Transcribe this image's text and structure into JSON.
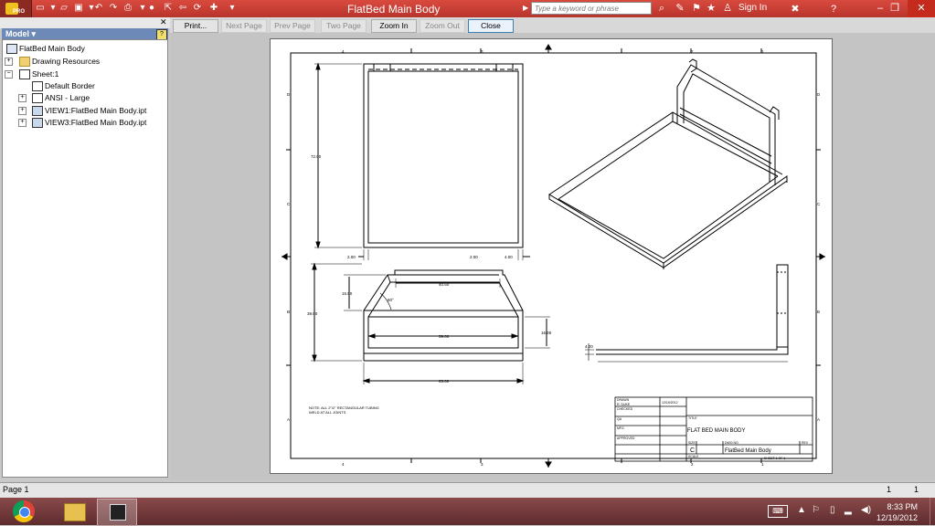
{
  "window": {
    "title": "FlatBed Main Body",
    "app_badge": "PRO",
    "search_placeholder": "Type a keyword or phrase",
    "sign_in": "Sign In"
  },
  "browser": {
    "header": "Model",
    "help_glyph": "?",
    "tree": [
      {
        "label": "FlatBed Main Body",
        "icon": "drawing-icon",
        "level": 0
      },
      {
        "label": "Drawing Resources",
        "icon": "folder-icon",
        "level": 1,
        "expander": "+"
      },
      {
        "label": "Sheet:1",
        "icon": "sheet-icon",
        "level": 1,
        "expander": "-"
      },
      {
        "label": "Default Border",
        "icon": "border-icon",
        "level": 2
      },
      {
        "label": "ANSI - Large",
        "icon": "titleblock-icon",
        "level": 2,
        "expander": "+"
      },
      {
        "label": "VIEW1:FlatBed Main Body.ipt",
        "icon": "view-icon",
        "level": 2,
        "expander": "+"
      },
      {
        "label": "VIEW3:FlatBed Main Body.ipt",
        "icon": "view-icon",
        "level": 2,
        "expander": "+"
      }
    ]
  },
  "toolbar": {
    "print": "Print...",
    "next_page": "Next Page",
    "prev_page": "Prev Page",
    "two_page": "Two Page",
    "zoom_in": "Zoom In",
    "zoom_out": "Zoom Out",
    "close": "Close"
  },
  "drawing": {
    "dims": {
      "height_front": "72.00",
      "height_side": "39.00",
      "dim_200": "2.00",
      "dim_200b": "2.00",
      "dim_400a": "4.00",
      "dim_4050": "40.50",
      "dim_1550": "15.50",
      "angle": "60°",
      "dim_5900": "59.00",
      "dim_1600": "16.00",
      "dim_6300": "63.00",
      "dim_400b": "4.00"
    },
    "zone_numbers": [
      "4",
      "3",
      "2",
      "1"
    ],
    "zone_letters": [
      "D",
      "C",
      "B",
      "A"
    ],
    "note_line1": "NOTE: ALL 2\"/2\" RECTANGULAR TUBING",
    "note_line2": "WELD AT ALL JOINTS",
    "title_block": {
      "drawn_label": "DRAWN",
      "drawn_by": "R. DUKE",
      "drawn_date": "12/19/2012",
      "checked_label": "CHECKED",
      "qa_label": "QA",
      "mfg_label": "MFG",
      "approved_label": "APPROVED",
      "title_label": "TITLE",
      "title": "FLAT BED MAIN BODY",
      "size_label": "SIZE",
      "size": "C",
      "dwg_label": "DWG NO",
      "dwg_no": "FlatBed Main Body",
      "rev_label": "REV",
      "scale_label": "SCALE",
      "sheet": "SHEET 1  OF 1"
    }
  },
  "status": {
    "page": "Page 1",
    "num1": "1",
    "num2": "1"
  },
  "taskbar": {
    "time": "8:33 PM",
    "date": "12/19/2012"
  }
}
